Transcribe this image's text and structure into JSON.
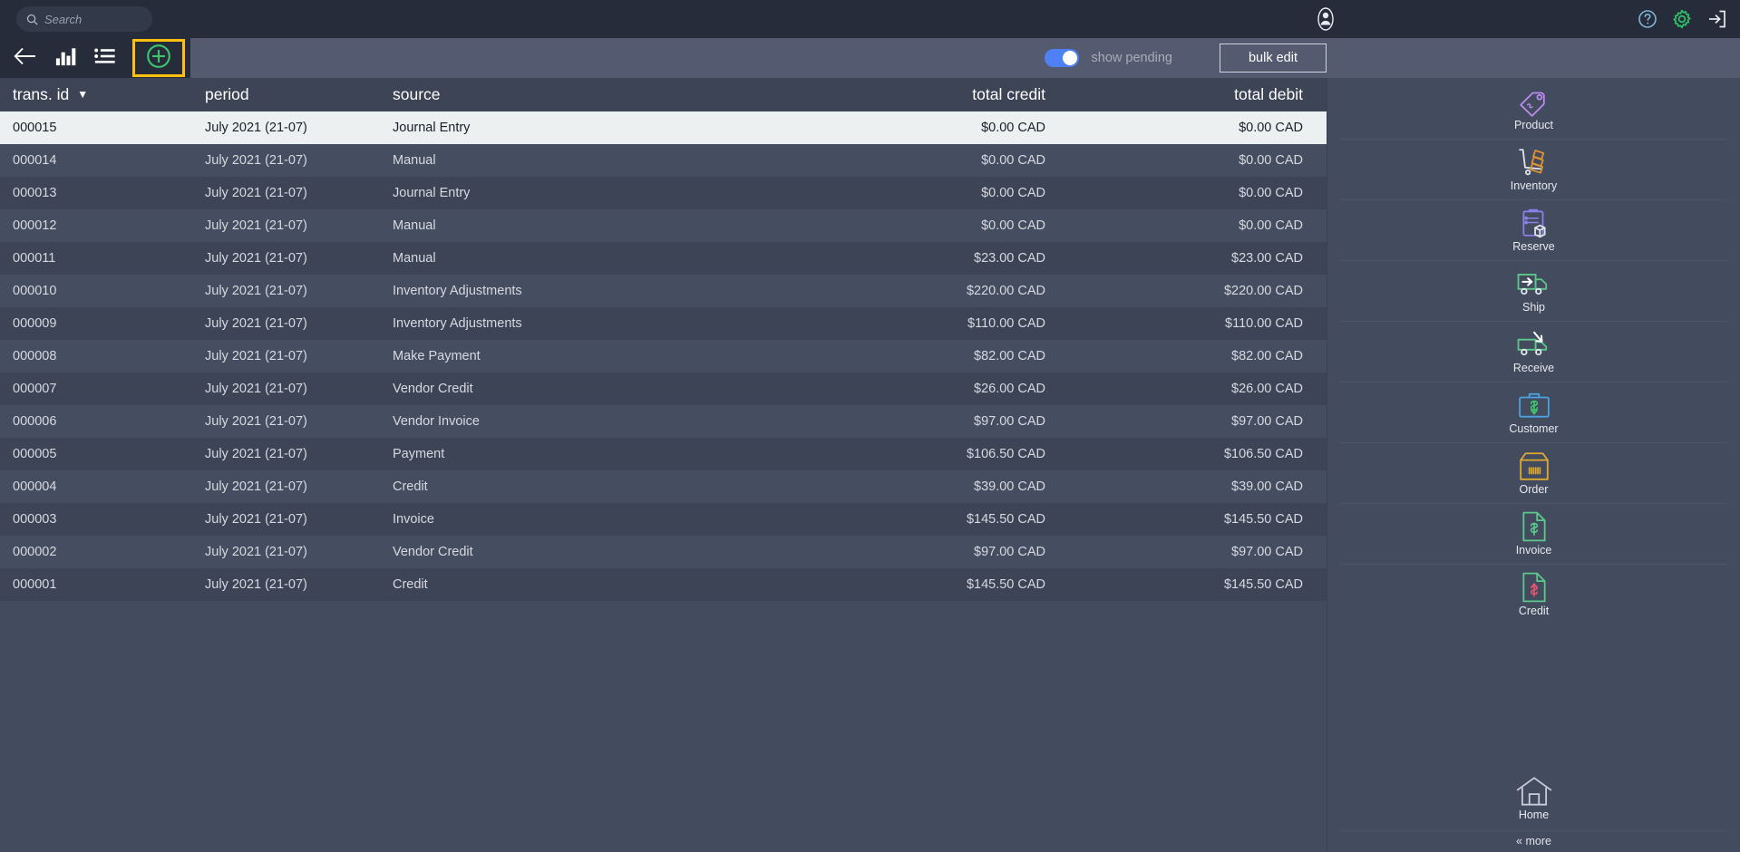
{
  "topbar": {
    "search_placeholder": "Search",
    "search_value": "",
    "icons": {
      "search": "search-icon",
      "avatar": "user-avatar-icon",
      "help": "help-circle-icon",
      "settings": "gear-icon",
      "logout": "logout-icon"
    }
  },
  "toolbar": {
    "back_label": "back",
    "chart_label": "chart",
    "list_label": "list",
    "add_label": "add",
    "toggle_label": "show pending",
    "toggle_on": true,
    "bulk_edit_label": "bulk edit",
    "accent_highlight": "#ffc10e",
    "toggle_color": "#4e81f4"
  },
  "table": {
    "columns": [
      {
        "key": "id",
        "label": "trans. id",
        "align": "left",
        "sorted": true,
        "sort_caret": "▼"
      },
      {
        "key": "period",
        "label": "period",
        "align": "left",
        "sorted": false
      },
      {
        "key": "source",
        "label": "source",
        "align": "left",
        "sorted": false
      },
      {
        "key": "credit",
        "label": "total credit",
        "align": "right",
        "sorted": false
      },
      {
        "key": "debit",
        "label": "total debit",
        "align": "right",
        "sorted": false
      }
    ],
    "rows": [
      {
        "id": "000015",
        "period": "July 2021 (21-07)",
        "source": "Journal Entry",
        "credit": "$0.00 CAD",
        "debit": "$0.00 CAD",
        "selected": true
      },
      {
        "id": "000014",
        "period": "July 2021 (21-07)",
        "source": "Manual",
        "credit": "$0.00 CAD",
        "debit": "$0.00 CAD",
        "selected": false
      },
      {
        "id": "000013",
        "period": "July 2021 (21-07)",
        "source": "Journal Entry",
        "credit": "$0.00 CAD",
        "debit": "$0.00 CAD",
        "selected": false
      },
      {
        "id": "000012",
        "period": "July 2021 (21-07)",
        "source": "Manual",
        "credit": "$0.00 CAD",
        "debit": "$0.00 CAD",
        "selected": false
      },
      {
        "id": "000011",
        "period": "July 2021 (21-07)",
        "source": "Manual",
        "credit": "$23.00 CAD",
        "debit": "$23.00 CAD",
        "selected": false
      },
      {
        "id": "000010",
        "period": "July 2021 (21-07)",
        "source": "Inventory Adjustments",
        "credit": "$220.00 CAD",
        "debit": "$220.00 CAD",
        "selected": false
      },
      {
        "id": "000009",
        "period": "July 2021 (21-07)",
        "source": "Inventory Adjustments",
        "credit": "$110.00 CAD",
        "debit": "$110.00 CAD",
        "selected": false
      },
      {
        "id": "000008",
        "period": "July 2021 (21-07)",
        "source": "Make Payment",
        "credit": "$82.00 CAD",
        "debit": "$82.00 CAD",
        "selected": false
      },
      {
        "id": "000007",
        "period": "July 2021 (21-07)",
        "source": "Vendor Credit",
        "credit": "$26.00 CAD",
        "debit": "$26.00 CAD",
        "selected": false
      },
      {
        "id": "000006",
        "period": "July 2021 (21-07)",
        "source": "Vendor Invoice",
        "credit": "$97.00 CAD",
        "debit": "$97.00 CAD",
        "selected": false
      },
      {
        "id": "000005",
        "period": "July 2021 (21-07)",
        "source": "Payment",
        "credit": "$106.50 CAD",
        "debit": "$106.50 CAD",
        "selected": false
      },
      {
        "id": "000004",
        "period": "July 2021 (21-07)",
        "source": "Credit",
        "credit": "$39.00 CAD",
        "debit": "$39.00 CAD",
        "selected": false
      },
      {
        "id": "000003",
        "period": "July 2021 (21-07)",
        "source": "Invoice",
        "credit": "$145.50 CAD",
        "debit": "$145.50 CAD",
        "selected": false
      },
      {
        "id": "000002",
        "period": "July 2021 (21-07)",
        "source": "Vendor Credit",
        "credit": "$97.00 CAD",
        "debit": "$97.00 CAD",
        "selected": false
      },
      {
        "id": "000001",
        "period": "July 2021 (21-07)",
        "source": "Credit",
        "credit": "$145.50 CAD",
        "debit": "$145.50 CAD",
        "selected": false
      }
    ]
  },
  "sidebar": {
    "items": [
      {
        "label": "Product",
        "icon": "price-tag-icon",
        "color": "#b98cf0"
      },
      {
        "label": "Inventory",
        "icon": "hand-truck-boxes-icon",
        "color": "#e0922f"
      },
      {
        "label": "Reserve",
        "icon": "clipboard-box-icon",
        "color": "#8b7fe8"
      },
      {
        "label": "Ship",
        "icon": "truck-arrow-out-icon",
        "color": "#5cc98a"
      },
      {
        "label": "Receive",
        "icon": "truck-arrow-in-icon",
        "color": "#5cc98a"
      },
      {
        "label": "Customer",
        "icon": "briefcase-dollar-icon",
        "color": "#4aa3e0"
      },
      {
        "label": "Order",
        "icon": "box-barcode-icon",
        "color": "#e0a92f"
      },
      {
        "label": "Invoice",
        "icon": "document-dollar-icon",
        "color": "#5cc98a"
      },
      {
        "label": "Credit",
        "icon": "document-credit-icon",
        "color": "#5cc98a"
      }
    ],
    "home": {
      "label": "Home",
      "icon": "home-icon"
    },
    "more": {
      "label": "« more"
    }
  }
}
